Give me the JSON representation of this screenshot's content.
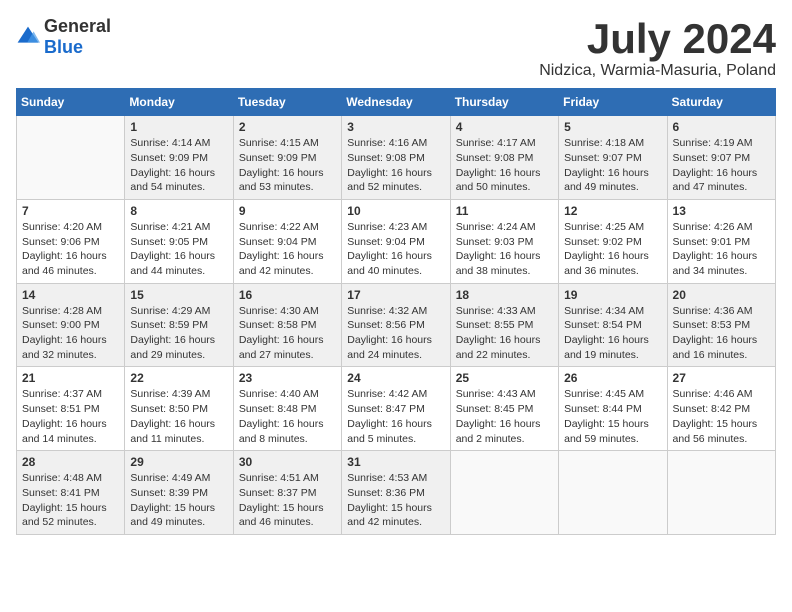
{
  "logo": {
    "general": "General",
    "blue": "Blue"
  },
  "title": "July 2024",
  "location": "Nidzica, Warmia-Masuria, Poland",
  "weekdays": [
    "Sunday",
    "Monday",
    "Tuesday",
    "Wednesday",
    "Thursday",
    "Friday",
    "Saturday"
  ],
  "weeks": [
    [
      {
        "day": "",
        "info": ""
      },
      {
        "day": "1",
        "info": "Sunrise: 4:14 AM\nSunset: 9:09 PM\nDaylight: 16 hours\nand 54 minutes."
      },
      {
        "day": "2",
        "info": "Sunrise: 4:15 AM\nSunset: 9:09 PM\nDaylight: 16 hours\nand 53 minutes."
      },
      {
        "day": "3",
        "info": "Sunrise: 4:16 AM\nSunset: 9:08 PM\nDaylight: 16 hours\nand 52 minutes."
      },
      {
        "day": "4",
        "info": "Sunrise: 4:17 AM\nSunset: 9:08 PM\nDaylight: 16 hours\nand 50 minutes."
      },
      {
        "day": "5",
        "info": "Sunrise: 4:18 AM\nSunset: 9:07 PM\nDaylight: 16 hours\nand 49 minutes."
      },
      {
        "day": "6",
        "info": "Sunrise: 4:19 AM\nSunset: 9:07 PM\nDaylight: 16 hours\nand 47 minutes."
      }
    ],
    [
      {
        "day": "7",
        "info": "Sunrise: 4:20 AM\nSunset: 9:06 PM\nDaylight: 16 hours\nand 46 minutes."
      },
      {
        "day": "8",
        "info": "Sunrise: 4:21 AM\nSunset: 9:05 PM\nDaylight: 16 hours\nand 44 minutes."
      },
      {
        "day": "9",
        "info": "Sunrise: 4:22 AM\nSunset: 9:04 PM\nDaylight: 16 hours\nand 42 minutes."
      },
      {
        "day": "10",
        "info": "Sunrise: 4:23 AM\nSunset: 9:04 PM\nDaylight: 16 hours\nand 40 minutes."
      },
      {
        "day": "11",
        "info": "Sunrise: 4:24 AM\nSunset: 9:03 PM\nDaylight: 16 hours\nand 38 minutes."
      },
      {
        "day": "12",
        "info": "Sunrise: 4:25 AM\nSunset: 9:02 PM\nDaylight: 16 hours\nand 36 minutes."
      },
      {
        "day": "13",
        "info": "Sunrise: 4:26 AM\nSunset: 9:01 PM\nDaylight: 16 hours\nand 34 minutes."
      }
    ],
    [
      {
        "day": "14",
        "info": "Sunrise: 4:28 AM\nSunset: 9:00 PM\nDaylight: 16 hours\nand 32 minutes."
      },
      {
        "day": "15",
        "info": "Sunrise: 4:29 AM\nSunset: 8:59 PM\nDaylight: 16 hours\nand 29 minutes."
      },
      {
        "day": "16",
        "info": "Sunrise: 4:30 AM\nSunset: 8:58 PM\nDaylight: 16 hours\nand 27 minutes."
      },
      {
        "day": "17",
        "info": "Sunrise: 4:32 AM\nSunset: 8:56 PM\nDaylight: 16 hours\nand 24 minutes."
      },
      {
        "day": "18",
        "info": "Sunrise: 4:33 AM\nSunset: 8:55 PM\nDaylight: 16 hours\nand 22 minutes."
      },
      {
        "day": "19",
        "info": "Sunrise: 4:34 AM\nSunset: 8:54 PM\nDaylight: 16 hours\nand 19 minutes."
      },
      {
        "day": "20",
        "info": "Sunrise: 4:36 AM\nSunset: 8:53 PM\nDaylight: 16 hours\nand 16 minutes."
      }
    ],
    [
      {
        "day": "21",
        "info": "Sunrise: 4:37 AM\nSunset: 8:51 PM\nDaylight: 16 hours\nand 14 minutes."
      },
      {
        "day": "22",
        "info": "Sunrise: 4:39 AM\nSunset: 8:50 PM\nDaylight: 16 hours\nand 11 minutes."
      },
      {
        "day": "23",
        "info": "Sunrise: 4:40 AM\nSunset: 8:48 PM\nDaylight: 16 hours\nand 8 minutes."
      },
      {
        "day": "24",
        "info": "Sunrise: 4:42 AM\nSunset: 8:47 PM\nDaylight: 16 hours\nand 5 minutes."
      },
      {
        "day": "25",
        "info": "Sunrise: 4:43 AM\nSunset: 8:45 PM\nDaylight: 16 hours\nand 2 minutes."
      },
      {
        "day": "26",
        "info": "Sunrise: 4:45 AM\nSunset: 8:44 PM\nDaylight: 15 hours\nand 59 minutes."
      },
      {
        "day": "27",
        "info": "Sunrise: 4:46 AM\nSunset: 8:42 PM\nDaylight: 15 hours\nand 56 minutes."
      }
    ],
    [
      {
        "day": "28",
        "info": "Sunrise: 4:48 AM\nSunset: 8:41 PM\nDaylight: 15 hours\nand 52 minutes."
      },
      {
        "day": "29",
        "info": "Sunrise: 4:49 AM\nSunset: 8:39 PM\nDaylight: 15 hours\nand 49 minutes."
      },
      {
        "day": "30",
        "info": "Sunrise: 4:51 AM\nSunset: 8:37 PM\nDaylight: 15 hours\nand 46 minutes."
      },
      {
        "day": "31",
        "info": "Sunrise: 4:53 AM\nSunset: 8:36 PM\nDaylight: 15 hours\nand 42 minutes."
      },
      {
        "day": "",
        "info": ""
      },
      {
        "day": "",
        "info": ""
      },
      {
        "day": "",
        "info": ""
      }
    ]
  ]
}
